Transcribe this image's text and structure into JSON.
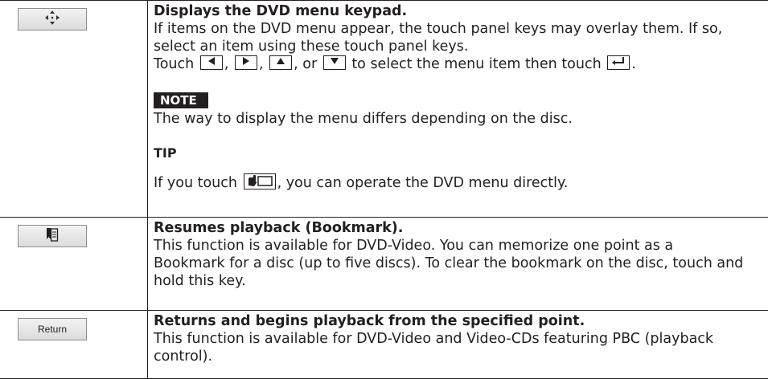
{
  "rows": [
    {
      "key_icon": "dvd-menu-keypad-icon",
      "title": "Displays the DVD menu keypad.",
      "lines": [
        "If items on the DVD menu appear, the touch panel keys may overlay them. If so,",
        "select an item using these touch panel keys."
      ],
      "touch_line": {
        "prefix": "Touch",
        "sep1": ",",
        "sep2": ",",
        "sep3": ", or",
        "mid": "to select the menu item then touch",
        "end": "."
      },
      "note": {
        "label": "NOTE",
        "text": "The way to display the menu differs depending on the disc."
      },
      "tip": {
        "label": "TIP",
        "prefix": "If you touch",
        "suffix": ", you can operate the DVD menu directly."
      }
    },
    {
      "key_icon": "bookmark-icon",
      "title": "Resumes playback (Bookmark).",
      "lines": [
        "This function is available for DVD-Video. You can memorize one point as a",
        "Bookmark for a disc (up to five discs). To clear the bookmark on the disc, touch and",
        "hold this key."
      ]
    },
    {
      "key_label": "Return",
      "title": "Returns and begins playback from the specified point.",
      "lines": [
        "This function is available for DVD-Video and Video-CDs featuring PBC (playback",
        "control)."
      ]
    }
  ],
  "icons": {
    "left": "left-arrow-icon",
    "right": "right-arrow-icon",
    "up": "up-arrow-icon",
    "down": "down-arrow-icon",
    "enter": "enter-icon",
    "direct": "direct-touch-icon"
  }
}
